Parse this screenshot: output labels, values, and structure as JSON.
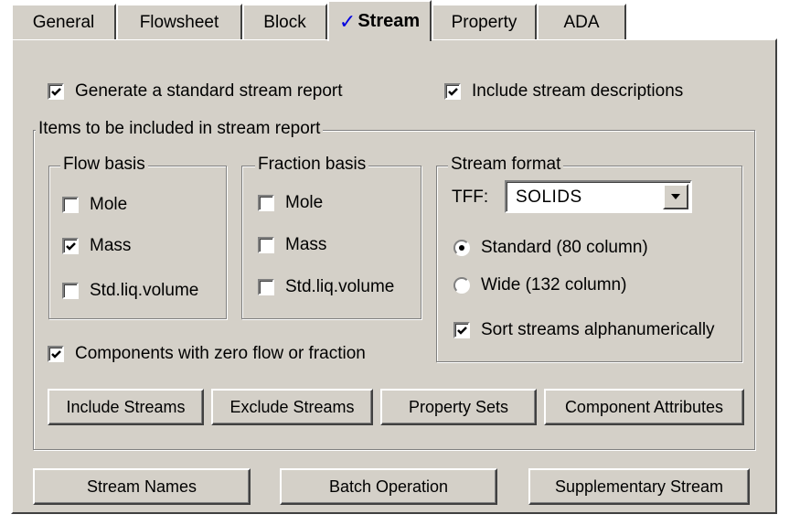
{
  "tabs": [
    {
      "label": "General",
      "active": false
    },
    {
      "label": "Flowsheet",
      "active": false
    },
    {
      "label": "Block",
      "active": false
    },
    {
      "label": "Stream",
      "active": true,
      "checkmark": "✓"
    },
    {
      "label": "Property",
      "active": false
    },
    {
      "label": "ADA",
      "active": false
    }
  ],
  "options": {
    "generate_report": {
      "label": "Generate a standard stream report",
      "checked": true
    },
    "include_descriptions": {
      "label": "Include stream descriptions",
      "checked": true
    }
  },
  "items_group": {
    "legend": "Items to be included in stream report",
    "flow_basis": {
      "legend": "Flow basis",
      "items": [
        {
          "label": "Mole",
          "checked": false
        },
        {
          "label": "Mass",
          "checked": true
        },
        {
          "label": "Std.liq.volume",
          "checked": false
        }
      ]
    },
    "fraction_basis": {
      "legend": "Fraction basis",
      "items": [
        {
          "label": "Mole",
          "checked": false
        },
        {
          "label": "Mass",
          "checked": false
        },
        {
          "label": "Std.liq.volume",
          "checked": false
        }
      ]
    },
    "stream_format": {
      "legend": "Stream format",
      "tff_label": "TFF:",
      "tff_value": "SOLIDS",
      "radios": [
        {
          "label": "Standard (80 column)",
          "selected": true
        },
        {
          "label": "Wide (132 column)",
          "selected": false
        }
      ],
      "sort": {
        "label": "Sort streams alphanumerically",
        "checked": true
      }
    },
    "zero_flow": {
      "label": "Components with zero flow or fraction",
      "checked": true
    },
    "buttons": {
      "include_streams": "Include Streams",
      "exclude_streams": "Exclude Streams",
      "property_sets": "Property Sets",
      "component_attributes": "Component Attributes"
    }
  },
  "bottom_buttons": {
    "stream_names": "Stream Names",
    "batch_operation": "Batch Operation",
    "supplementary_stream": "Supplementary Stream"
  },
  "colors": {
    "panel": "#d4d0c8",
    "check_accent": "#0000e0"
  }
}
